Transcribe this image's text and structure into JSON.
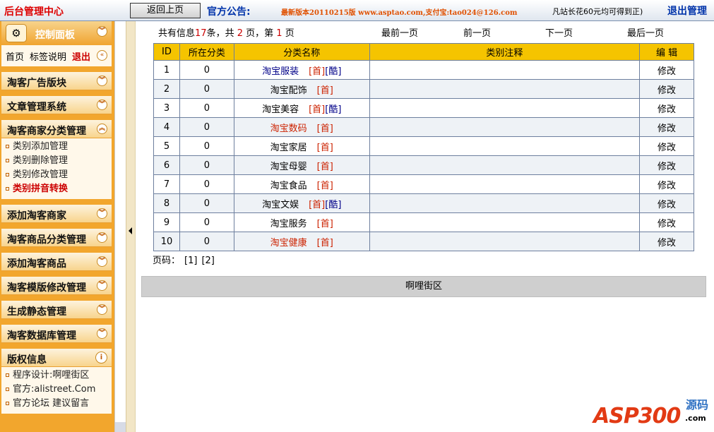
{
  "topbar": {
    "app_title": "后台管理中心",
    "back_button": "返回上页",
    "notice_label": "官方公告:",
    "notice_text": "最新版本20110215版 www.asptao.com,支付宝:tao024@126.com",
    "notice_tail": "凡站长花60元均可得到正)",
    "logout": "退出管理"
  },
  "sidebar": {
    "control_panel": {
      "title": "控制面板",
      "quick_links": [
        "首页",
        "标签说明"
      ],
      "logout": "退出"
    },
    "sections": [
      {
        "title": "淘客广告版块",
        "expanded": false,
        "items": []
      },
      {
        "title": "文章管理系统",
        "expanded": false,
        "items": []
      },
      {
        "title": "淘客商家分类管理",
        "expanded": true,
        "items": [
          "类别添加管理",
          "类别删除管理",
          "类别修改管理",
          "类别拼音转换"
        ],
        "active_item": "类别拼音转换"
      },
      {
        "title": "添加淘客商家",
        "expanded": false,
        "items": []
      },
      {
        "title": "淘客商品分类管理",
        "expanded": false,
        "items": []
      },
      {
        "title": "添加淘客商品",
        "expanded": false,
        "items": []
      },
      {
        "title": "淘客模版修改管理",
        "expanded": false,
        "items": []
      },
      {
        "title": "生成静态管理",
        "expanded": false,
        "items": []
      },
      {
        "title": "淘客数据库管理",
        "expanded": false,
        "items": []
      }
    ],
    "copyright": {
      "title": "版权信息",
      "items": [
        "程序设计:啊哩街区",
        "官方:alistreet.Com",
        "官方论坛 建议留言"
      ]
    },
    "icons": {
      "collapse": "chevron-down-icon",
      "expand": "chevron-up-icon",
      "info": "info-icon"
    }
  },
  "pager": {
    "total_prefix": "共有信息",
    "total": "17",
    "total_mid": "条，共",
    "pages": "2",
    "page_mid": "页，第",
    "current": "1",
    "page_suffix": "页",
    "first": "最前一页",
    "prev": "前一页",
    "next": "下一页",
    "last": "最后一页",
    "bottom_label": "页码：",
    "bottom_pages": [
      "[1]",
      "[2]"
    ]
  },
  "table": {
    "headers": [
      "ID",
      "所在分类",
      "分类名称",
      "类别注释",
      "编 辑"
    ],
    "rows": [
      {
        "id": "1",
        "parent": "0",
        "name": "淘宝服装",
        "name_color": "blue",
        "links": [
          "[首]",
          "[酷]"
        ],
        "note": "",
        "edit": "修改"
      },
      {
        "id": "2",
        "parent": "0",
        "name": "淘宝配饰",
        "name_color": "black",
        "links": [
          "[首]"
        ],
        "note": "",
        "edit": "修改"
      },
      {
        "id": "3",
        "parent": "0",
        "name": "淘宝美容",
        "name_color": "black",
        "links": [
          "[首]",
          "[酷]"
        ],
        "note": "",
        "edit": "修改"
      },
      {
        "id": "4",
        "parent": "0",
        "name": "淘宝数码",
        "name_color": "red",
        "links": [
          "[首]"
        ],
        "note": "",
        "edit": "修改"
      },
      {
        "id": "5",
        "parent": "0",
        "name": "淘宝家居",
        "name_color": "black",
        "links": [
          "[首]"
        ],
        "note": "",
        "edit": "修改"
      },
      {
        "id": "6",
        "parent": "0",
        "name": "淘宝母婴",
        "name_color": "black",
        "links": [
          "[首]"
        ],
        "note": "",
        "edit": "修改"
      },
      {
        "id": "7",
        "parent": "0",
        "name": "淘宝食品",
        "name_color": "black",
        "links": [
          "[首]"
        ],
        "note": "",
        "edit": "修改"
      },
      {
        "id": "8",
        "parent": "0",
        "name": "淘宝文娱",
        "name_color": "black",
        "links": [
          "[首]",
          "[酷]"
        ],
        "note": "",
        "edit": "修改"
      },
      {
        "id": "9",
        "parent": "0",
        "name": "淘宝服务",
        "name_color": "black",
        "links": [
          "[首]"
        ],
        "note": "",
        "edit": "修改"
      },
      {
        "id": "10",
        "parent": "0",
        "name": "淘宝健康",
        "name_color": "red",
        "links": [
          "[首]"
        ],
        "note": "",
        "edit": "修改"
      }
    ]
  },
  "footer": {
    "text": "啊哩街区"
  },
  "watermark": {
    "asp": "ASP300",
    "source": "源码",
    "com": ".com"
  },
  "colors": {
    "header_yellow": "#f5c400",
    "sidebar_orange": "#f2a62d",
    "link_red": "#cc2200",
    "link_blue": "#000088",
    "title_red": "#dd0000"
  }
}
